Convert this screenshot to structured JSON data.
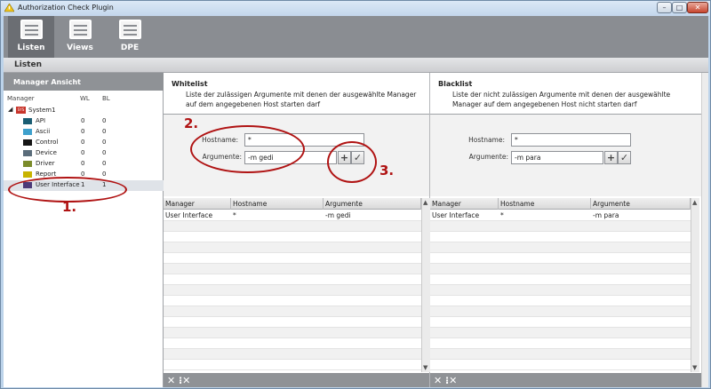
{
  "window": {
    "title": "Authorization Check Plugin",
    "minimize": "–",
    "maximize": "□",
    "close": "✕"
  },
  "toolbar": {
    "tabs": [
      {
        "label": "Listen"
      },
      {
        "label": "Views"
      },
      {
        "label": "DPE"
      }
    ]
  },
  "subheader": {
    "title": "Listen"
  },
  "left_panel": {
    "title": "Manager Ansicht",
    "columns": {
      "manager": "Manager",
      "wl": "WL",
      "bl": "BL"
    },
    "system": {
      "label": "System1",
      "badge": "SYS"
    },
    "items": [
      {
        "label": "API",
        "wl": "0",
        "bl": "0",
        "color": "#1a5d73"
      },
      {
        "label": "Ascii",
        "wl": "0",
        "bl": "0",
        "color": "#3ea0cc"
      },
      {
        "label": "Control",
        "wl": "0",
        "bl": "0",
        "color": "#151515"
      },
      {
        "label": "Device",
        "wl": "0",
        "bl": "0",
        "color": "#5a6c7a"
      },
      {
        "label": "Driver",
        "wl": "0",
        "bl": "0",
        "color": "#7b8b2a"
      },
      {
        "label": "Report",
        "wl": "0",
        "bl": "0",
        "color": "#c8b400"
      },
      {
        "label": "User Interface",
        "wl": "1",
        "bl": "1",
        "color": "#4c3a78"
      }
    ]
  },
  "whitelist": {
    "title": "Whitelist",
    "description": "Liste der zulässigen Argumente mit denen der ausgewählte Manager auf dem angegebenen Host starten darf",
    "hostname_label": "Hostname:",
    "hostname_value": "*",
    "argumente_label": "Argumente:",
    "argumente_value": "-m gedi",
    "columns": [
      "Manager",
      "Hostname",
      "Argumente"
    ],
    "rows": [
      {
        "manager": "User Interface",
        "hostname": "*",
        "argumente": "-m gedi"
      }
    ]
  },
  "blacklist": {
    "title": "Blacklist",
    "description": "Liste der nicht zulässigen Argumente mit denen der ausgewählte Manager auf dem angegebenen Host nicht starten darf",
    "hostname_label": "Hostname:",
    "hostname_value": "*",
    "argumente_label": "Argumente:",
    "argumente_value": "-m para",
    "columns": [
      "Manager",
      "Hostname",
      "Argumente"
    ],
    "rows": [
      {
        "manager": "User Interface",
        "hostname": "*",
        "argumente": "-m para"
      }
    ]
  },
  "icons": {
    "add": "+",
    "confirm": "✓",
    "delete": "✕",
    "delete_all": "⁝✕",
    "scroll_up": "▲",
    "scroll_down": "▼"
  },
  "annotations": {
    "one": "1.",
    "two": "2.",
    "three": "3.",
    "color": "#b01313"
  }
}
